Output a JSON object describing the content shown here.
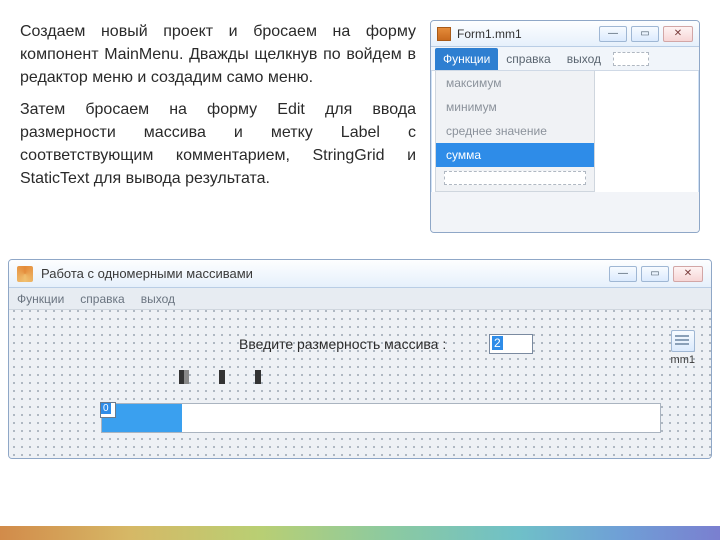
{
  "text": {
    "para1": "Создаем новый проект и бросаем на форму компонент MainMenu. Дважды щелкнув по войдем в редактор меню и создадим само меню.",
    "para2": "Затем бросаем на форму Edit для ввода размерности массива и метку Label с соответствующим комментарием, StringGrid и StaticText для вывода результата."
  },
  "miniWindow": {
    "title": "Form1.mm1",
    "menu": {
      "items": [
        "Функции",
        "справка",
        "выход"
      ],
      "activeIndex": 0
    },
    "dropdown": {
      "items": [
        "максимум",
        "минимум",
        "среднее значение",
        "сумма"
      ],
      "selectedIndex": 3
    },
    "buttons": {
      "min": "—",
      "max": "▭",
      "close": "✕"
    }
  },
  "bigWindow": {
    "title": "Работа с одномерными массивами",
    "menu": {
      "items": [
        "Функции",
        "справка",
        "выход"
      ]
    },
    "label": "Введите размерность массива :",
    "editValue": "2",
    "gridIndex": "0",
    "componentLabel": "mm1",
    "buttons": {
      "min": "—",
      "max": "▭",
      "close": "✕"
    }
  }
}
